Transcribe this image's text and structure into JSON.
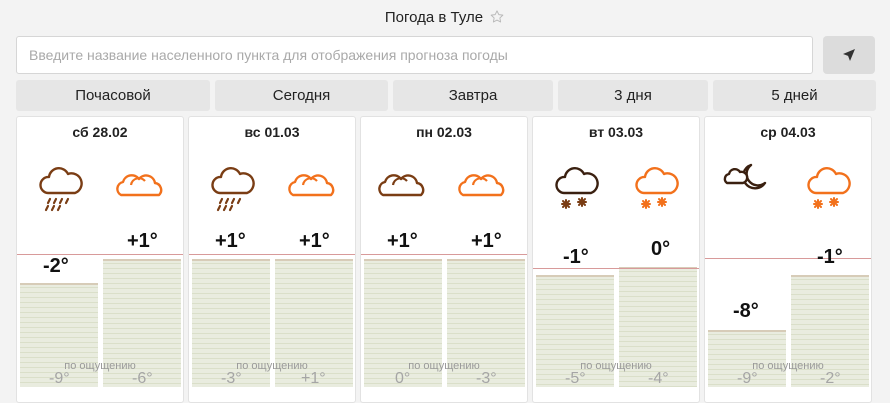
{
  "header": {
    "title": "Погода в Туле",
    "star_icon": "star-outline-icon"
  },
  "search": {
    "placeholder": "Введите название населенного пункта для отображения прогноза погоды",
    "locate_icon": "location-arrow-icon"
  },
  "tabs": [
    {
      "label": "Почасовой"
    },
    {
      "label": "Сегодня"
    },
    {
      "label": "Завтра"
    },
    {
      "label": "3 дня"
    },
    {
      "label": "5 дней"
    }
  ],
  "colors": {
    "dark_icon": "#7a3d14",
    "orange_icon": "#f2711c",
    "bar": "#e9ecdf",
    "zero_line": "#d89a9a"
  },
  "days": [
    {
      "date": "сб 28.02",
      "day_icon": "cloud-rain-icon",
      "night_icon": "cloudy-icon",
      "day_temp": "-2°",
      "night_temp": "+1°",
      "feels_label": "по ощущению",
      "feels_day": "-9°",
      "feels_night": "-6°"
    },
    {
      "date": "вс 01.03",
      "day_icon": "cloud-rain-icon",
      "night_icon": "cloudy-icon",
      "day_temp": "+1°",
      "night_temp": "+1°",
      "feels_label": "по ощущению",
      "feels_day": "-3°",
      "feels_night": "+1°"
    },
    {
      "date": "пн 02.03",
      "day_icon": "cloudy-icon",
      "night_icon": "cloudy-icon",
      "day_temp": "+1°",
      "night_temp": "+1°",
      "feels_label": "по ощущению",
      "feels_day": "0°",
      "feels_night": "-3°"
    },
    {
      "date": "вт 03.03",
      "day_icon": "cloud-snow-icon",
      "night_icon": "cloud-snow-icon",
      "day_temp": "-1°",
      "night_temp": "0°",
      "feels_label": "по ощущению",
      "feels_day": "-5°",
      "feels_night": "-4°"
    },
    {
      "date": "ср 04.03",
      "day_icon": "cloud-moon-icon",
      "night_icon": "cloud-snow-icon",
      "day_temp": "-8°",
      "night_temp": "-1°",
      "feels_label": "по ощущению",
      "feels_day": "-9°",
      "feels_night": "-2°"
    }
  ]
}
